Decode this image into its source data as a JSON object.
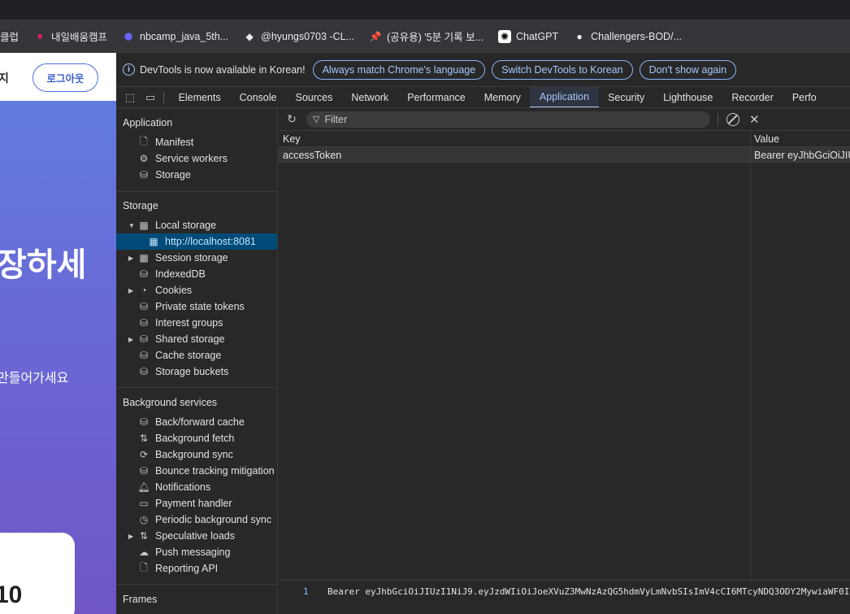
{
  "bookmarks": [
    {
      "icon": "bookmark-icon",
      "glyph": "",
      "label": "클럽"
    },
    {
      "icon": "heart-icon",
      "glyph": "♥",
      "label": "내일배움캠프"
    },
    {
      "icon": "hexagon-icon",
      "glyph": "⬢",
      "label": "nbcamp_java_5th..."
    },
    {
      "icon": "diamond-icon",
      "glyph": "◆",
      "label": "@hyungs0703 -CL..."
    },
    {
      "icon": "pin-icon",
      "glyph": "📌",
      "label": "(공유용) '5분 기록 보..."
    },
    {
      "icon": "openai-icon",
      "glyph": "✺",
      "label": "ChatGPT"
    },
    {
      "icon": "github-icon",
      "glyph": "●",
      "label": "Challengers-BOD/..."
    }
  ],
  "page": {
    "header_char": "지",
    "logout_label": "로그아웃",
    "hero_title": "장하세",
    "hero_subtitle": "만들어가세요",
    "card_text": "10"
  },
  "devtools": {
    "info_message": "DevTools is now available in Korean!",
    "buttons": {
      "match_language": "Always match Chrome's language",
      "switch_korean": "Switch DevTools to Korean",
      "dont_show": "Don't show again"
    },
    "tabs": [
      "Elements",
      "Console",
      "Sources",
      "Network",
      "Performance",
      "Memory",
      "Application",
      "Security",
      "Lighthouse",
      "Recorder",
      "Perfo"
    ],
    "active_tab": "Application",
    "sidebar": {
      "application": {
        "title": "Application",
        "items": [
          "Manifest",
          "Service workers",
          "Storage"
        ]
      },
      "storage": {
        "title": "Storage",
        "local_storage": "Local storage",
        "local_storage_origin": "http://localhost:8081",
        "items": [
          "Session storage",
          "IndexedDB",
          "Cookies",
          "Private state tokens",
          "Interest groups",
          "Shared storage",
          "Cache storage",
          "Storage buckets"
        ]
      },
      "background_services": {
        "title": "Background services",
        "items": [
          "Back/forward cache",
          "Background fetch",
          "Background sync",
          "Bounce tracking mitigation",
          "Notifications",
          "Payment handler",
          "Periodic background sync",
          "Speculative loads",
          "Push messaging",
          "Reporting API"
        ]
      },
      "frames": {
        "title": "Frames"
      }
    },
    "filter": {
      "placeholder": "Filter"
    },
    "table": {
      "columns": [
        "Key",
        "Value"
      ],
      "rows": [
        {
          "key": "accessToken",
          "value": "Bearer eyJhbGciOiJIUzI1NiJ9.eyJzdWIiOiJoeXVuZ3MwNzAzQG5hdmVyLmNvbSIsImV4cCI6MTcyNDQ3ODY2MywiaWF0I"
        }
      ]
    },
    "preview": {
      "line_number": "1",
      "code": "Bearer eyJhbGciOiJIUzI1NiJ9.eyJzdWIiOiJoeXVuZ3MwNzAzQG5hdmVyLmNvbSIsImV4cCI6MTcyNDQ3ODY2MywiaWF0I"
    }
  }
}
